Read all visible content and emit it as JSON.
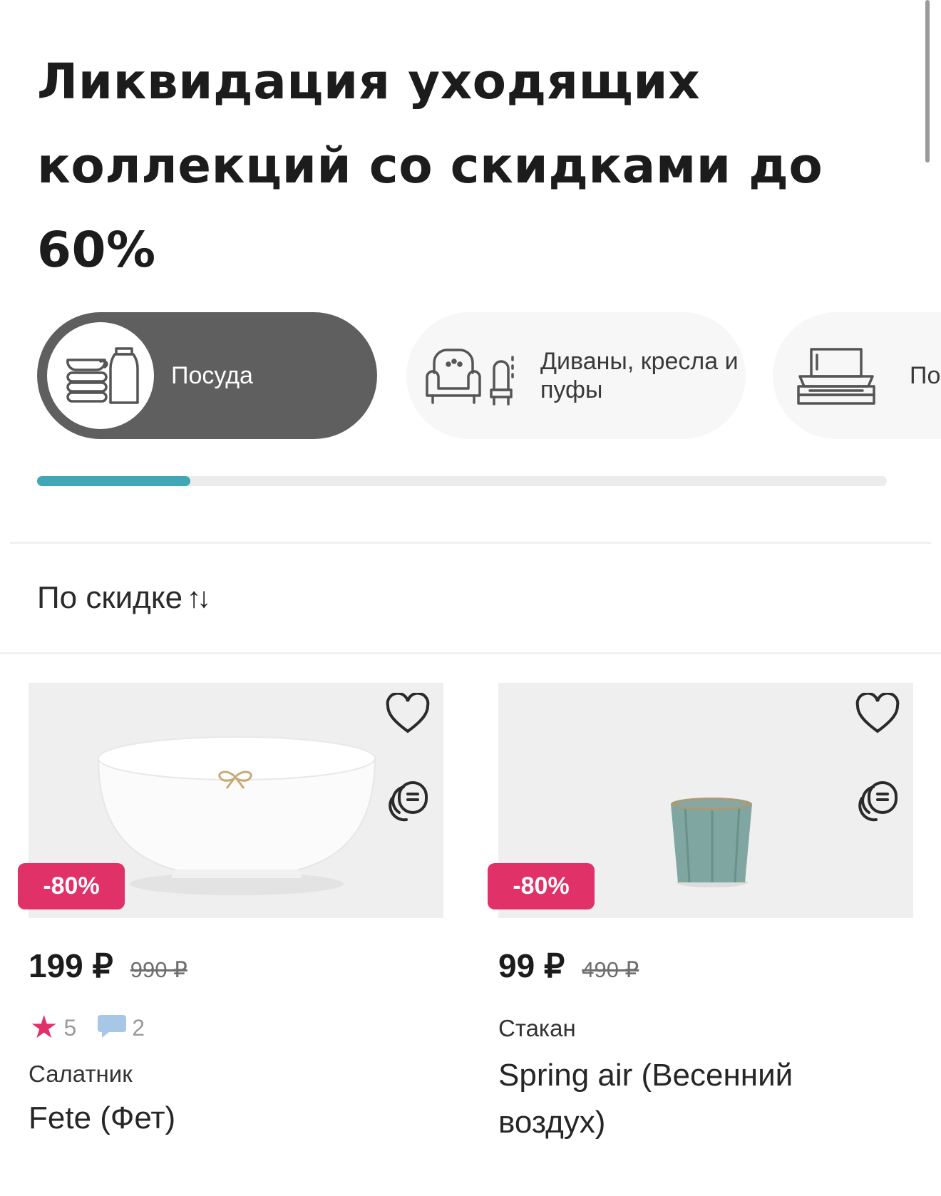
{
  "title": "Ликвидация уходящих коллекций со скидками до 60%",
  "categories": [
    {
      "label": "Посуда",
      "icon": "dishes-icon",
      "active": true
    },
    {
      "label": "Диваны, кресла и пуфы",
      "icon": "armchair-icon",
      "active": false
    },
    {
      "label": "По од",
      "icon": "bedding-icon",
      "active": false
    }
  ],
  "category_scroll": {
    "progress": 0.18
  },
  "sort": {
    "label": "По скидке",
    "icon": "sort-arrows-icon",
    "arrows": "↑↓"
  },
  "products": [
    {
      "discount": "-80%",
      "price": "199 ₽",
      "old_price": "990 ₽",
      "rating": "5",
      "reviews": "2",
      "type": "Салатник",
      "name": "Fete (Фет)"
    },
    {
      "discount": "-80%",
      "price": "99 ₽",
      "old_price": "490 ₽",
      "type": "Стакан",
      "name": "Spring air (Весенний воздух)"
    }
  ],
  "colors": {
    "accent": "#e03168",
    "progress": "#3fa7b5",
    "active_pill": "#5f5f5f"
  }
}
